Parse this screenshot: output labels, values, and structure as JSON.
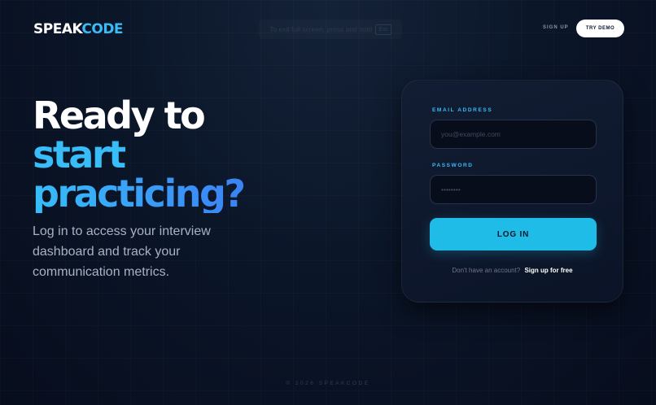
{
  "brand": {
    "part1": "SPEAK",
    "part2": "CODE"
  },
  "fullscreen_hint": {
    "text": "To exit full screen, press and hold",
    "key": "Esc"
  },
  "nav": {
    "sign_up": "SIGN UP",
    "try_demo": "TRY DEMO"
  },
  "hero": {
    "line1": "Ready to",
    "line2": "start",
    "line3": "practicing?",
    "subtitle": "Log in to access your interview dashboard and track your communication metrics."
  },
  "login_form": {
    "email_label": "EMAIL ADDRESS",
    "email_placeholder": "you@example.com",
    "password_label": "PASSWORD",
    "password_placeholder": "••••••••",
    "login_button": "LOG IN",
    "no_account_text": "Don't have an account?",
    "signup_link": "Sign up for free"
  },
  "footer": {
    "copyright": "© 2026 SPEAKCODE"
  },
  "colors": {
    "accent": "#38bdf8",
    "button": "#1ebce6",
    "background": "#0b1629"
  }
}
